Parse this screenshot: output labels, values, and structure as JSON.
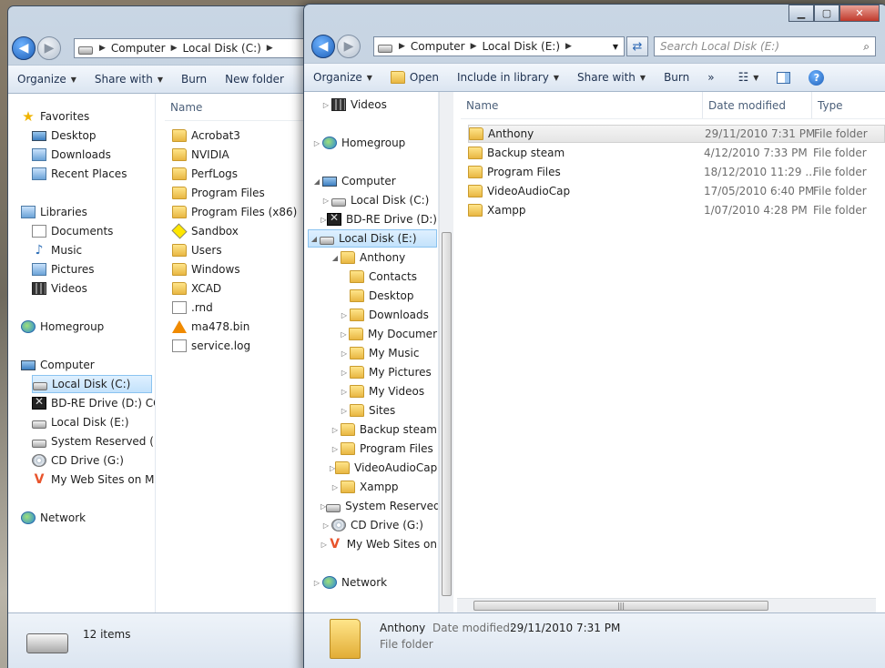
{
  "left_window": {
    "breadcrumb": [
      "Computer",
      "Local Disk (C:)"
    ],
    "toolbar": [
      "Organize",
      "Share with",
      "Burn",
      "New folder"
    ],
    "nav": [
      {
        "label": "Favorites",
        "icon": "star-icon"
      },
      {
        "label": "Desktop",
        "icon": "desktop-icon"
      },
      {
        "label": "Downloads",
        "icon": "downloads-icon"
      },
      {
        "label": "Recent Places",
        "icon": "recent-places-icon"
      },
      {
        "label": "Libraries",
        "icon": "libraries-icon"
      },
      {
        "label": "Documents",
        "icon": "documents-icon"
      },
      {
        "label": "Music",
        "icon": "music-icon"
      },
      {
        "label": "Pictures",
        "icon": "pictures-icon"
      },
      {
        "label": "Videos",
        "icon": "videos-icon"
      },
      {
        "label": "Homegroup",
        "icon": "homegroup-icon"
      },
      {
        "label": "Computer",
        "icon": "computer-icon"
      },
      {
        "label": "Local Disk (C:)",
        "icon": "drive-icon"
      },
      {
        "label": "BD-RE Drive (D:) CO",
        "icon": "bd-drive-icon"
      },
      {
        "label": "Local Disk (E:)",
        "icon": "drive-icon"
      },
      {
        "label": "System Reserved (F:)",
        "icon": "drive-icon"
      },
      {
        "label": "CD Drive (G:)",
        "icon": "cd-drive-icon"
      },
      {
        "label": "My Web Sites on MS",
        "icon": "web-sites-icon"
      },
      {
        "label": "Network",
        "icon": "network-icon"
      }
    ],
    "column_name": "Name",
    "files": [
      {
        "name": "Acrobat3",
        "icon": "folder-icon"
      },
      {
        "name": "NVIDIA",
        "icon": "folder-icon"
      },
      {
        "name": "PerfLogs",
        "icon": "folder-icon"
      },
      {
        "name": "Program Files",
        "icon": "folder-icon"
      },
      {
        "name": "Program Files (x86)",
        "icon": "folder-icon"
      },
      {
        "name": "Sandbox",
        "icon": "sandbox-icon"
      },
      {
        "name": "Users",
        "icon": "folder-icon"
      },
      {
        "name": "Windows",
        "icon": "folder-icon"
      },
      {
        "name": "XCAD",
        "icon": "folder-icon"
      },
      {
        "name": ".rnd",
        "icon": "file-icon"
      },
      {
        "name": "ma478.bin",
        "icon": "vlc-file-icon"
      },
      {
        "name": "service.log",
        "icon": "file-icon"
      }
    ],
    "status": "12 items"
  },
  "right_window": {
    "breadcrumb": [
      "Computer",
      "Local Disk (E:)"
    ],
    "search_placeholder": "Search Local Disk (E:)",
    "toolbar": [
      "Organize",
      "Open",
      "Include in library",
      "Share with",
      "Burn"
    ],
    "toolbar_more": "»",
    "nav": [
      {
        "label": "Videos",
        "icon": "videos-icon"
      },
      {
        "label": "Homegroup",
        "icon": "homegroup-icon"
      },
      {
        "label": "Computer",
        "icon": "computer-icon"
      },
      {
        "label": "Local Disk (C:)",
        "icon": "drive-icon"
      },
      {
        "label": "BD-RE Drive (D:)",
        "icon": "bd-drive-icon"
      },
      {
        "label": "Local Disk (E:)",
        "icon": "drive-icon"
      },
      {
        "label": "Anthony",
        "icon": "folder-icon"
      },
      {
        "label": "Contacts",
        "icon": "folder-icon"
      },
      {
        "label": "Desktop",
        "icon": "folder-icon"
      },
      {
        "label": "Downloads",
        "icon": "folder-icon"
      },
      {
        "label": "My Documer",
        "icon": "folder-icon"
      },
      {
        "label": "My Music",
        "icon": "folder-icon"
      },
      {
        "label": "My Pictures",
        "icon": "folder-icon"
      },
      {
        "label": "My Videos",
        "icon": "folder-icon"
      },
      {
        "label": "Sites",
        "icon": "folder-icon"
      },
      {
        "label": "Backup steam",
        "icon": "folder-icon"
      },
      {
        "label": "Program Files",
        "icon": "folder-icon"
      },
      {
        "label": "VideoAudioCap",
        "icon": "folder-icon"
      },
      {
        "label": "Xampp",
        "icon": "folder-icon"
      },
      {
        "label": "System Reserved",
        "icon": "drive-icon"
      },
      {
        "label": "CD Drive (G:)",
        "icon": "cd-drive-icon"
      },
      {
        "label": "My Web Sites on",
        "icon": "web-sites-icon"
      },
      {
        "label": "Network",
        "icon": "network-icon"
      }
    ],
    "columns": [
      "Name",
      "Date modified",
      "Type"
    ],
    "files": [
      {
        "name": "Anthony",
        "date": "29/11/2010 7:31 PM",
        "type": "File folder"
      },
      {
        "name": "Backup steam",
        "date": "4/12/2010 7:33 PM",
        "type": "File folder"
      },
      {
        "name": "Program Files",
        "date": "18/12/2010 11:29 ...",
        "type": "File folder"
      },
      {
        "name": "VideoAudioCap",
        "date": "17/05/2010 6:40 PM",
        "type": "File folder"
      },
      {
        "name": "Xampp",
        "date": "1/07/2010 4:28 PM",
        "type": "File folder"
      }
    ],
    "details": {
      "name": "Anthony",
      "date_label": "Date modified:",
      "date_value": "29/11/2010 7:31 PM",
      "type": "File folder"
    }
  }
}
